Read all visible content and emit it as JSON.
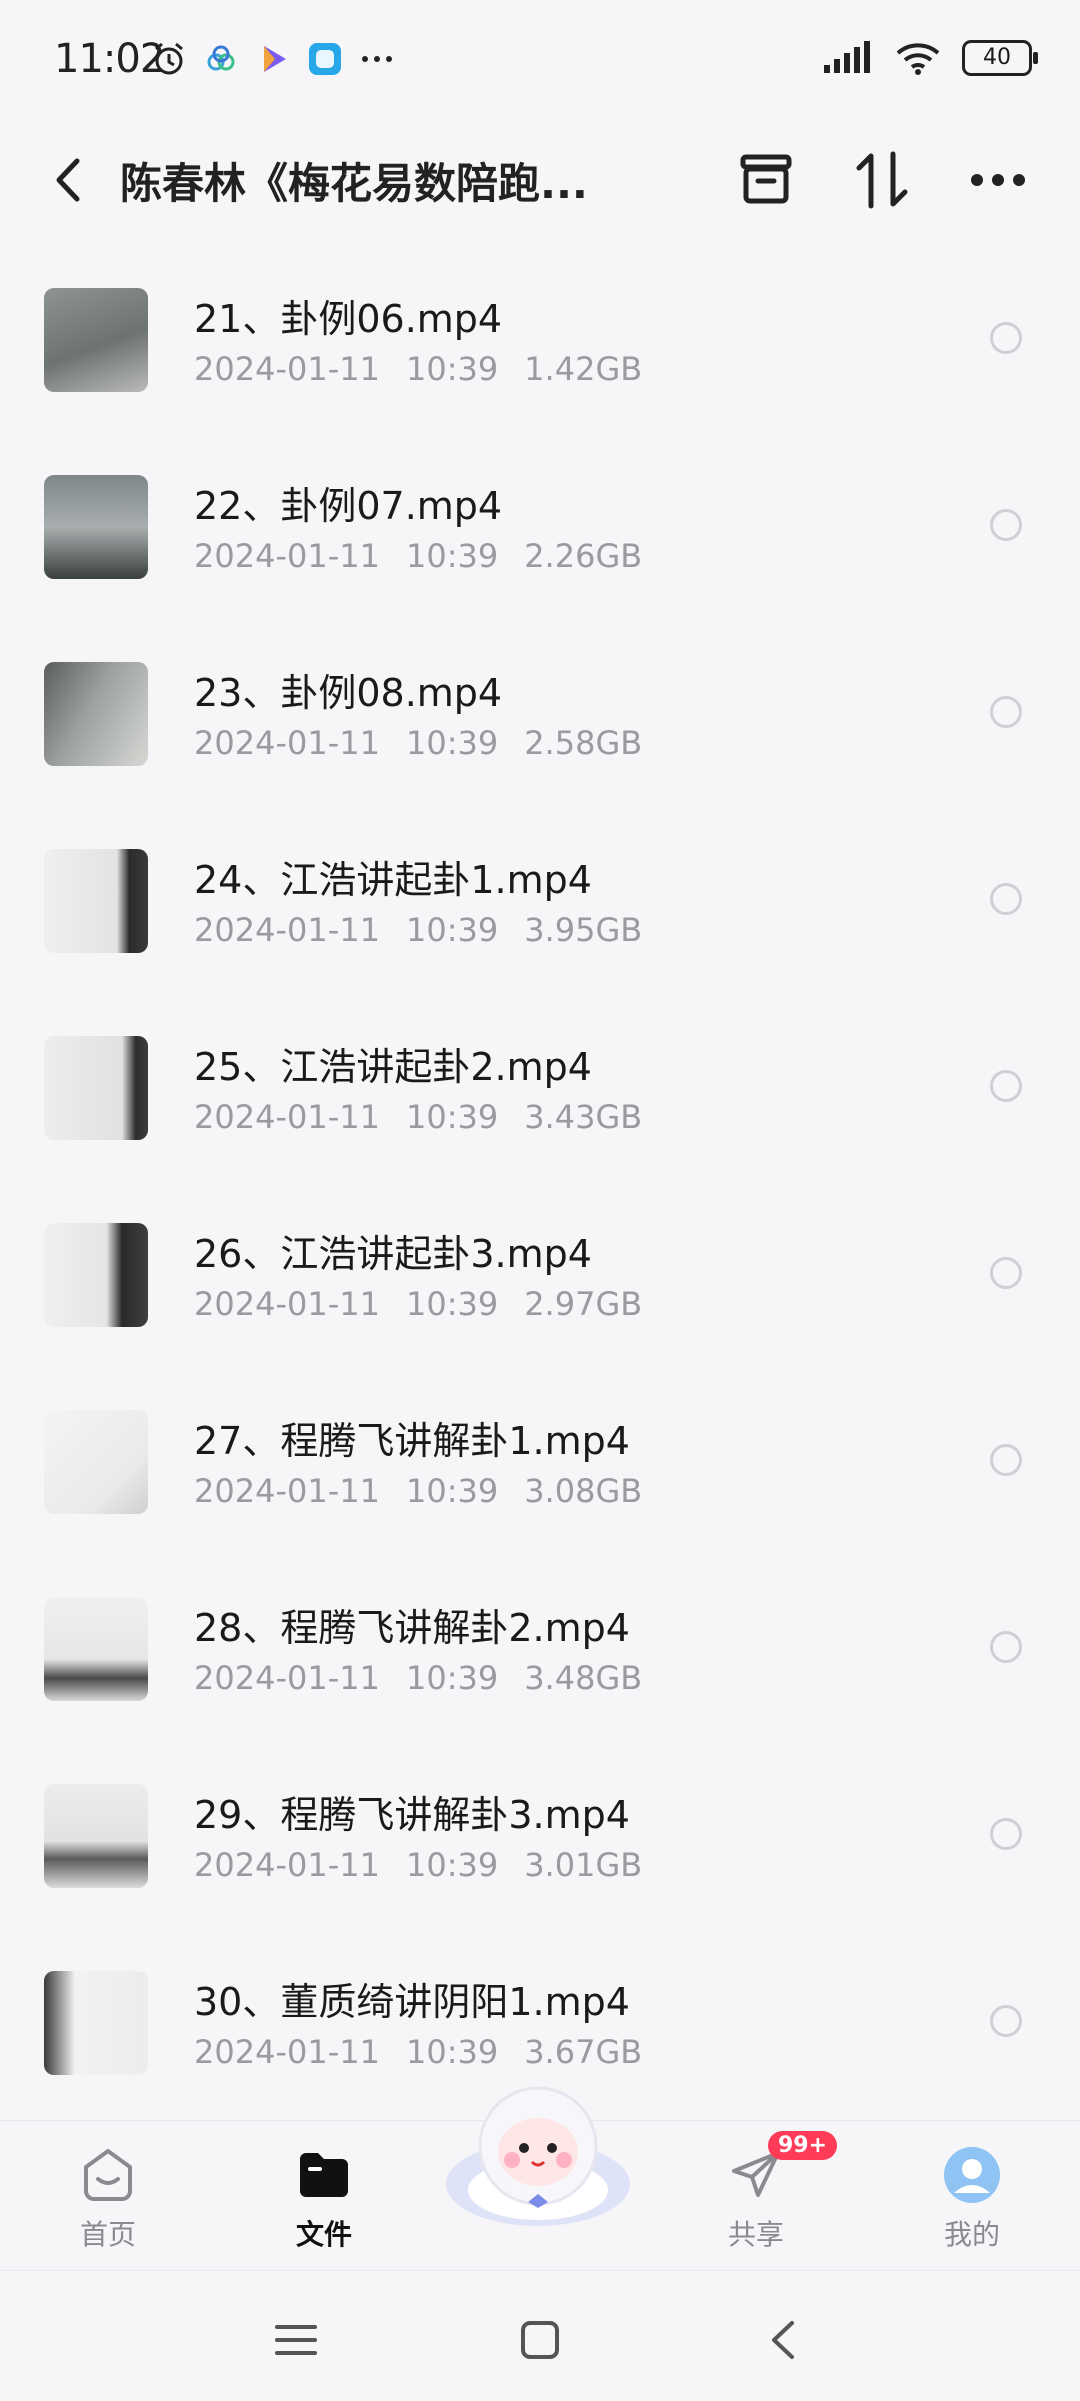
{
  "status": {
    "time": "11:02",
    "battery": "40"
  },
  "header": {
    "title": "陈春林《梅花易数陪跑..."
  },
  "files": [
    {
      "name": "21、卦例06.mp4",
      "date": "2024-01-11",
      "time": "10:39",
      "size": "1.42GB"
    },
    {
      "name": "22、卦例07.mp4",
      "date": "2024-01-11",
      "time": "10:39",
      "size": "2.26GB"
    },
    {
      "name": "23、卦例08.mp4",
      "date": "2024-01-11",
      "time": "10:39",
      "size": "2.58GB"
    },
    {
      "name": "24、江浩讲起卦1.mp4",
      "date": "2024-01-11",
      "time": "10:39",
      "size": "3.95GB"
    },
    {
      "name": "25、江浩讲起卦2.mp4",
      "date": "2024-01-11",
      "time": "10:39",
      "size": "3.43GB"
    },
    {
      "name": "26、江浩讲起卦3.mp4",
      "date": "2024-01-11",
      "time": "10:39",
      "size": "2.97GB"
    },
    {
      "name": "27、程腾飞讲解卦1.mp4",
      "date": "2024-01-11",
      "time": "10:39",
      "size": "3.08GB"
    },
    {
      "name": "28、程腾飞讲解卦2.mp4",
      "date": "2024-01-11",
      "time": "10:39",
      "size": "3.48GB"
    },
    {
      "name": "29、程腾飞讲解卦3.mp4",
      "date": "2024-01-11",
      "time": "10:39",
      "size": "3.01GB"
    },
    {
      "name": "30、董质绮讲阴阳1.mp4",
      "date": "2024-01-11",
      "time": "10:39",
      "size": "3.67GB"
    }
  ],
  "nav": {
    "home": "首页",
    "files": "文件",
    "share": "共享",
    "share_badge": "99+",
    "me": "我的"
  },
  "colors": {
    "accent": "#ff3b57",
    "meta": "#9a9a9f",
    "background": "#f6f6f8"
  }
}
